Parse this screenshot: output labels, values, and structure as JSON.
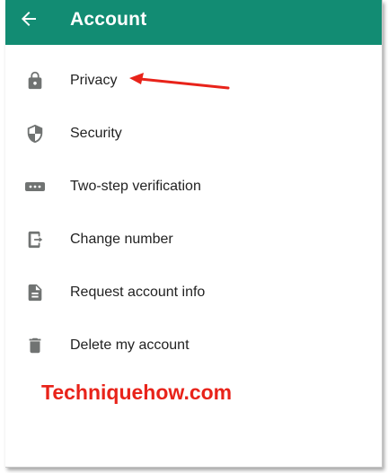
{
  "header": {
    "title": "Account",
    "back_icon": "arrow-back-icon",
    "color": "#128c73"
  },
  "menu": {
    "items": [
      {
        "label": "Privacy",
        "icon": "lock-icon"
      },
      {
        "label": "Security",
        "icon": "shield-icon"
      },
      {
        "label": "Two-step verification",
        "icon": "dots-icon"
      },
      {
        "label": "Change number",
        "icon": "phone-swap-icon"
      },
      {
        "label": "Request account info",
        "icon": "document-icon"
      },
      {
        "label": "Delete my account",
        "icon": "trash-icon"
      }
    ],
    "icon_color": "#707372"
  },
  "annotation": {
    "arrow_icon": "red-arrow-icon",
    "arrow_color": "#e8231a"
  },
  "watermark": {
    "text": "Techniquehow.com",
    "color": "#e8231a"
  }
}
